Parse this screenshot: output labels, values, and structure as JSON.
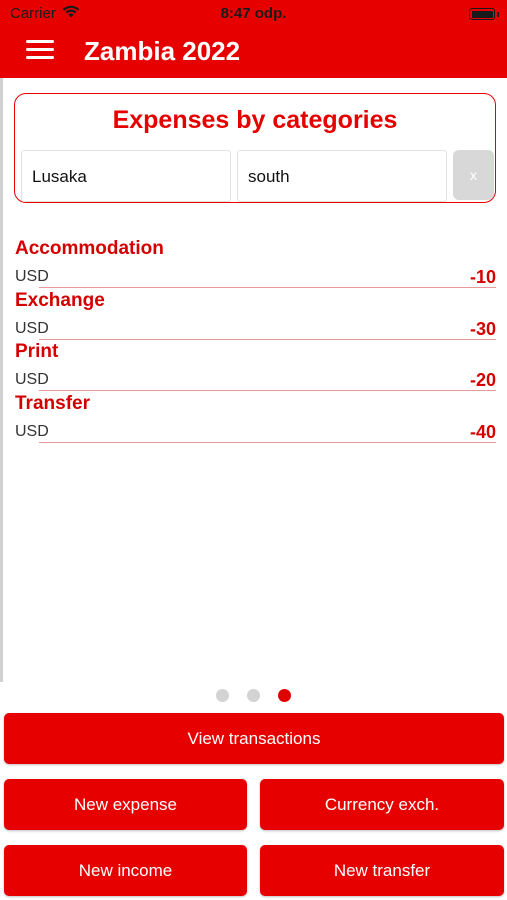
{
  "status_bar": {
    "carrier": "Carrier",
    "time": "8:47 odp.",
    "wifi_icon": "wifi-icon",
    "battery_icon": "battery-full-icon"
  },
  "nav": {
    "title": "Zambia 2022",
    "menu_icon": "hamburger-menu-icon"
  },
  "filter": {
    "title": "Expenses by categories",
    "city_value": "Lusaka",
    "region_value": "south",
    "clear_label": "x"
  },
  "categories": [
    {
      "name": "Accommodation",
      "currency": "USD",
      "amount": "-10"
    },
    {
      "name": "Exchange",
      "currency": "USD",
      "amount": "-30"
    },
    {
      "name": "Print",
      "currency": "USD",
      "amount": "-20"
    },
    {
      "name": "Transfer",
      "currency": "USD",
      "amount": "-40"
    }
  ],
  "pagination": {
    "total": 3,
    "active": 3
  },
  "actions": {
    "view_transactions": "View transactions",
    "new_expense": "New expense",
    "currency_exch": "Currency exch.",
    "new_income": "New income",
    "new_transfer": "New transfer"
  },
  "colors": {
    "accent": "#e60000",
    "amount_red": "#d40000",
    "dot_inactive": "#d3d3d3"
  }
}
